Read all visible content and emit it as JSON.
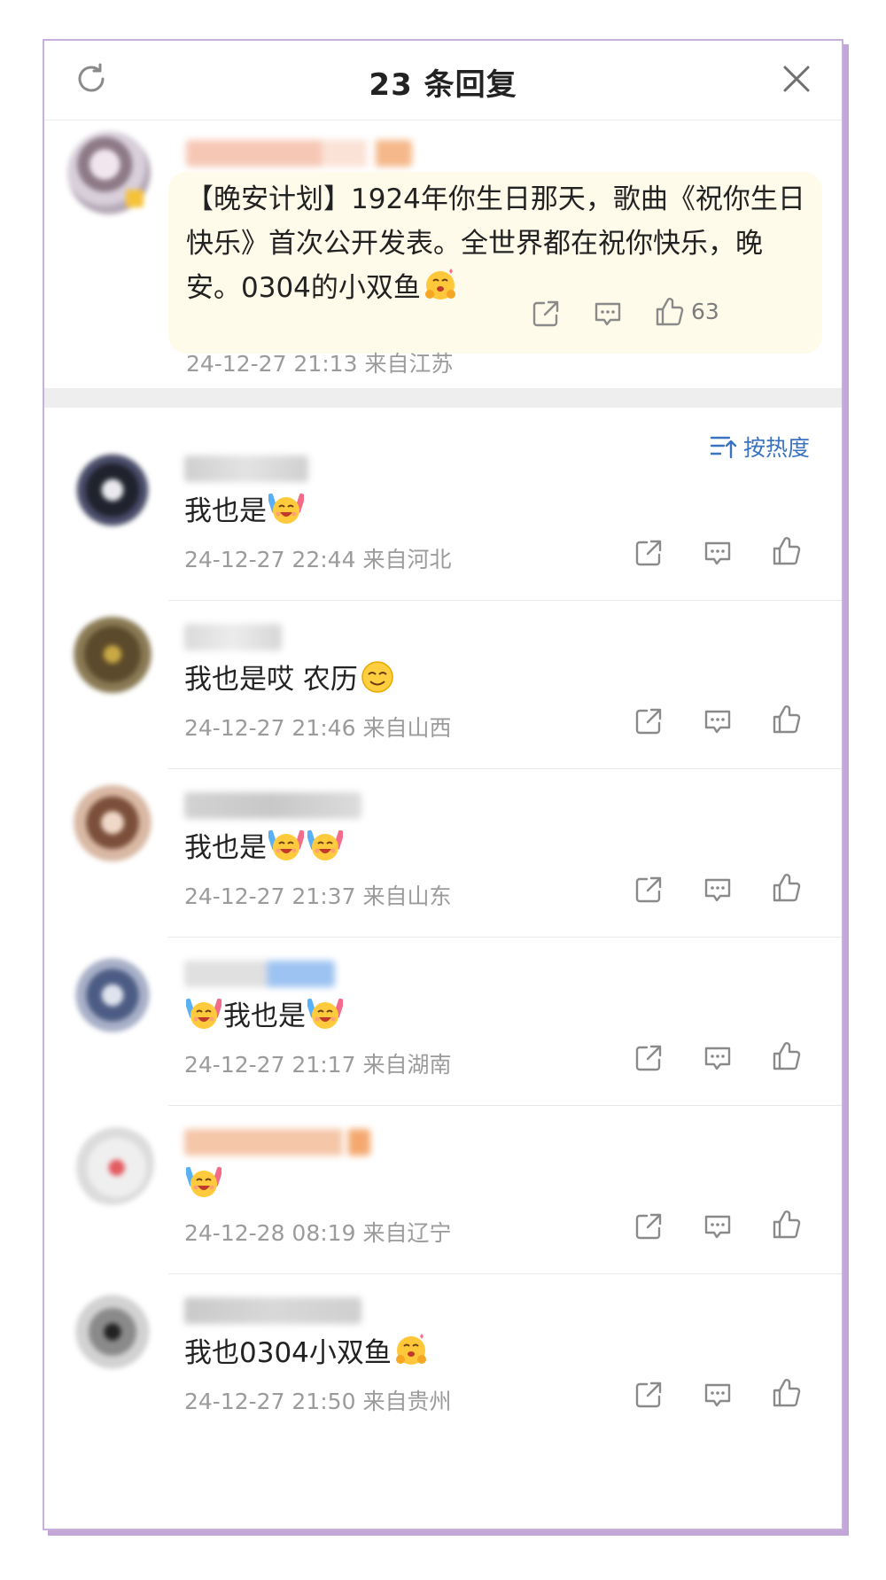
{
  "header": {
    "title": "23 条回复",
    "refresh_icon": "refresh-icon",
    "close_icon": "close-icon"
  },
  "original_post": {
    "text": "【晚安计划】1924年你生日那天，歌曲《祝你生日快乐》首次公开发表。全世界都在祝你快乐，晚安。0304的小双鱼",
    "emoji": "hug-emoji",
    "time": "24-12-27 21:13",
    "location": "来自江苏",
    "likes": "63",
    "bubble_color": "#fffbea"
  },
  "sort": {
    "label": "按热度",
    "icon": "sort-icon",
    "color": "#3b73c0"
  },
  "replies": [
    {
      "text": "我也是",
      "time": "24-12-27 22:44",
      "location": "来自河北"
    },
    {
      "text": "我也是哎 农历",
      "time": "24-12-27 21:46",
      "location": "来自山西"
    },
    {
      "text": "我也是",
      "time": "24-12-27 21:37",
      "location": "来自山东"
    },
    {
      "text": "我也是",
      "time": "24-12-27 21:17",
      "location": "来自湖南"
    },
    {
      "text": "",
      "time": "24-12-28 08:19",
      "location": "来自辽宁"
    },
    {
      "text": "我也0304小双鱼",
      "time": "24-12-27 21:50",
      "location": "来自贵州"
    }
  ],
  "icons": {
    "share": "share-icon",
    "comment": "comment-icon",
    "like": "like-icon"
  },
  "colors": {
    "meta_text": "#9b9b9b",
    "frame_border": "#c8b0dc"
  }
}
